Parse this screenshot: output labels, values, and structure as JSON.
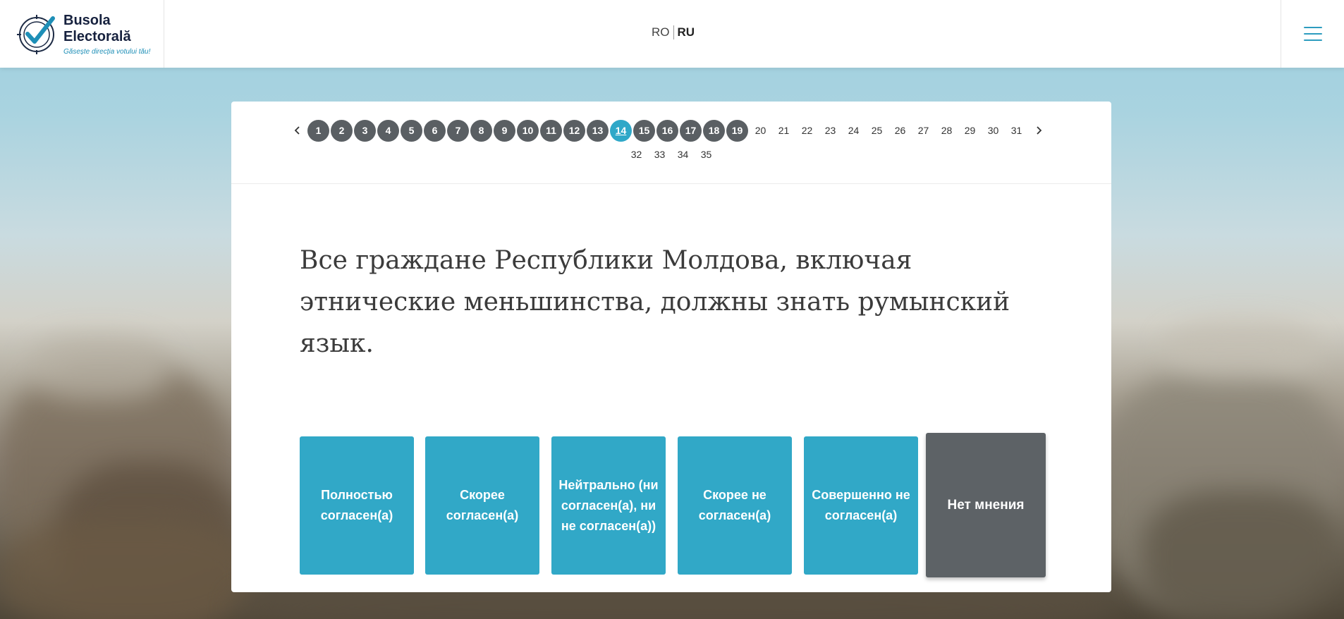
{
  "colors": {
    "accent": "#31a8c7",
    "done_question": "#5a5f63",
    "no_opinion": "#5d6266",
    "brand_navy": "#16213e"
  },
  "header": {
    "logo": {
      "title_line1": "Busola",
      "title_line2": "Electorală",
      "tagline": "Găsește direcția votului tău!",
      "icon": "compass-check-icon"
    },
    "languages": [
      {
        "code": "RO",
        "active": false
      },
      {
        "code": "RU",
        "active": true
      }
    ],
    "menu_icon": "hamburger-menu-icon"
  },
  "pager": {
    "prev_icon": "chevron-left-icon",
    "next_icon": "chevron-right-icon",
    "current": 14,
    "answered_count": 19,
    "row1": [
      "1",
      "2",
      "3",
      "4",
      "5",
      "6",
      "7",
      "8",
      "9",
      "10",
      "11",
      "12",
      "13",
      "14",
      "15",
      "16",
      "17",
      "18",
      "19",
      "20",
      "21",
      "22",
      "23",
      "24",
      "25",
      "26",
      "27",
      "28",
      "29",
      "30",
      "31"
    ],
    "row2": [
      "32",
      "33",
      "34",
      "35"
    ]
  },
  "question": {
    "text": "Все граждане Республики Молдова, включая этнические меньшинства, должны знать румынский язык."
  },
  "answers": [
    {
      "label": "Полностью согласен(а)"
    },
    {
      "label": "Скорее согласен(а)"
    },
    {
      "label": "Нейтрально (ни согласен(а), ни не согласен(а))"
    },
    {
      "label": "Скорее не согласен(а)"
    },
    {
      "label": "Совершенно не согласен(а)"
    },
    {
      "label": "Нет мнения"
    }
  ]
}
